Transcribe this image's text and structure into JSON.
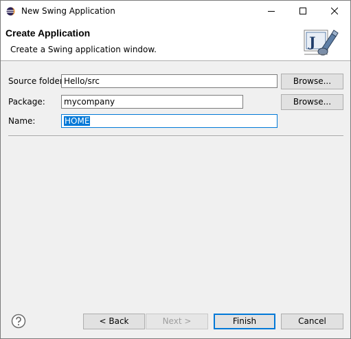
{
  "window": {
    "title": "New Swing Application"
  },
  "banner": {
    "title": "Create Application",
    "description": "Create a Swing application window.",
    "image_letter": "J"
  },
  "form": {
    "source_folder_label": "Source folder:",
    "source_folder_value": "Hello/src",
    "package_label": "Package:",
    "package_value": "mycompany",
    "name_label": "Name:",
    "name_value": "HOME",
    "browse_label": "Browse..."
  },
  "footer": {
    "back_label": "< Back",
    "next_label": "Next >",
    "finish_label": "Finish",
    "cancel_label": "Cancel"
  },
  "icons": {
    "help": "help-icon",
    "app": "eclipse-icon"
  },
  "colors": {
    "accent": "#0078d7",
    "dialog_bg": "#f0f0f0"
  }
}
